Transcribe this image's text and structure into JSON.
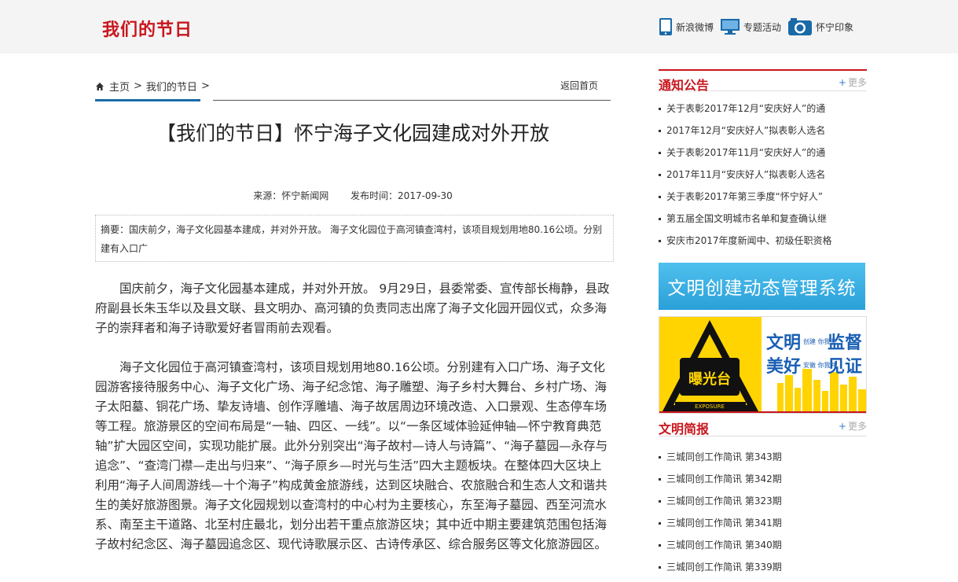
{
  "header": {
    "site_title": "我们的节日",
    "links": [
      {
        "label": "新浪微博",
        "icon": "phone-icon"
      },
      {
        "label": "专题活动",
        "icon": "monitor-icon"
      },
      {
        "label": "怀宁印象",
        "icon": "camera-icon"
      }
    ]
  },
  "breadcrumb": {
    "home": "主页",
    "sep": ">",
    "section": "我们的节日",
    "back_home": "返回首页"
  },
  "article": {
    "title": "【我们的节日】怀宁海子文化园建成对外开放",
    "source": "来源：怀宁新闻网",
    "published": "发布时间：2017-09-30",
    "summary": "摘要：国庆前夕，海子文化园基本建成，并对外开放。 海子文化园位于高河镇查湾村，该项目规划用地80.16公顷。分别建有入口广",
    "paragraphs": [
      "国庆前夕，海子文化园基本建成，并对外开放。 9月29日，县委常委、宣传部长梅静，县政府副县长朱玉华以及县文联、县文明办、高河镇的负责同志出席了海子文化园开园仪式，众多海子的崇拜者和海子诗歌爱好者冒雨前去观看。",
      "海子文化园位于高河镇查湾村，该项目规划用地80.16公顷。分别建有入口广场、海子文化园游客接待服务中心、海子文化广场、海子纪念馆、海子雕塑、海子乡村大舞台、乡村广场、海子太阳墓、铜花广场、挚友诗墙、创作浮雕墙、海子故居周边环境改造、入口景观、生态停车场等工程。旅游景区的空间布局是“一轴、四区、一线”。以“一条区域体验延伸轴—怀宁教育典范轴”扩大园区空间，实现功能扩展。此外分别突出“海子故村—诗人与诗篇”、“海子墓园—永存与追念”、“查湾门襟—走出与归来”、“海子原乡—时光与生活”四大主题板块。在整体四大区块上利用“海子人间周游线—十个海子”构成黄金旅游线，达到区块融合、农旅融合和生态人文和谐共生的美好旅游图景。海子文化园规划以查湾村的中心村为主要核心，东至海子墓园、西至河流水系、南至主干道路、北至村庄最北，划分出若干重点旅游区块；其中近中期主要建筑范围包括海子故村纪念区、海子墓园追念区、现代诗歌展示区、古诗传承区、综合服务区等文化旅游园区。"
    ]
  },
  "sidebar": {
    "notices": {
      "title": "通知公告",
      "more": "更多",
      "items": [
        "关于表彰2017年12月“安庆好人”的通",
        "2017年12月“安庆好人”拟表彰人选名",
        "关于表彰2017年11月“安庆好人”的通",
        "2017年11月“安庆好人”拟表彰人选名",
        "关于表彰2017年第三季度“怀宁好人”",
        "第五届全国文明城市名单和复查确认继",
        "安庆市2017年度新闻中、初级任职资格"
      ]
    },
    "banner_cms": "文明创建动态管理系统",
    "banner_exposure": {
      "badge": "曝光台",
      "badge_en": "EXPOSURE",
      "line1_a": "文明",
      "line1_small": "创建\n你我共",
      "line1_b": "监督",
      "line2_a": "美好",
      "line2_small": "安徽\n你我共",
      "line2_b": "见证"
    },
    "briefs": {
      "title": "文明简报",
      "more": "更多",
      "items": [
        "三城同创工作简讯 第343期",
        "三城同创工作简讯 第342期",
        "三城同创工作简讯 第323期",
        "三城同创工作简讯 第341期",
        "三城同创工作简讯 第340期",
        "三城同创工作简讯 第339期"
      ]
    }
  },
  "colors": {
    "brand_red": "#c8161d",
    "accent_blue": "#1a6aa8",
    "cms_blue": "#2aa0d8"
  }
}
